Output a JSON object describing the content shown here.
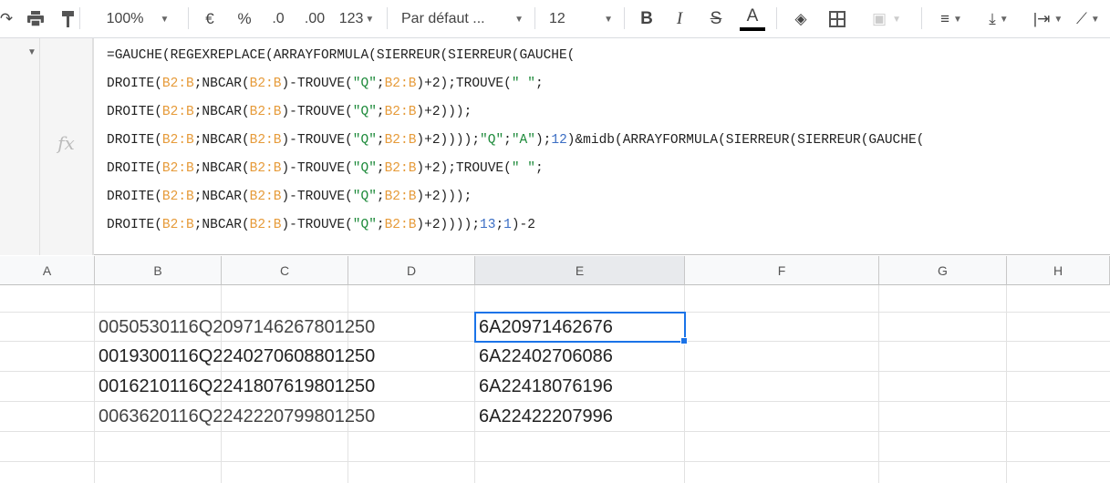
{
  "toolbar": {
    "zoom": "100%",
    "currency": "€",
    "percent": "%",
    "decrease_decimals": ".0",
    "increase_decimals": ".00",
    "more_formats": "123",
    "font": "Par défaut ...",
    "font_size": "12",
    "bold": "B",
    "italic": "I",
    "strikethrough": "S",
    "text_color_label": "A",
    "text_color": "#000000"
  },
  "formula_bar": {
    "fx": "fx",
    "lines": [
      [
        [
          "=GAUCHE(REGEXREPLACE(ARRAYFORMULA(SIERREUR(SIERREUR(GAUCHE(",
          "op"
        ]
      ],
      [
        [
          "DROITE(",
          "op"
        ],
        [
          "B2:B",
          "ref"
        ],
        [
          ";NBCAR(",
          "op"
        ],
        [
          "B2:B",
          "ref"
        ],
        [
          ")-TROUVE(",
          "op"
        ],
        [
          "\"Q\"",
          "str"
        ],
        [
          ";",
          "op"
        ],
        [
          "B2:B",
          "ref"
        ],
        [
          ")+2);TROUVE(",
          "op"
        ],
        [
          "\" \"",
          "str"
        ],
        [
          ";",
          "op"
        ]
      ],
      [
        [
          "DROITE(",
          "op"
        ],
        [
          "B2:B",
          "ref"
        ],
        [
          ";NBCAR(",
          "op"
        ],
        [
          "B2:B",
          "ref"
        ],
        [
          ")-TROUVE(",
          "op"
        ],
        [
          "\"Q\"",
          "str"
        ],
        [
          ";",
          "op"
        ],
        [
          "B2:B",
          "ref"
        ],
        [
          ")+2)));",
          "op"
        ]
      ],
      [
        [
          "DROITE(",
          "op"
        ],
        [
          "B2:B",
          "ref"
        ],
        [
          ";NBCAR(",
          "op"
        ],
        [
          "B2:B",
          "ref"
        ],
        [
          ")-TROUVE(",
          "op"
        ],
        [
          "\"Q\"",
          "str"
        ],
        [
          ";",
          "op"
        ],
        [
          "B2:B",
          "ref"
        ],
        [
          ")+2))));",
          "op"
        ],
        [
          "\"Q\"",
          "str"
        ],
        [
          ";",
          "op"
        ],
        [
          "\"A\"",
          "str"
        ],
        [
          ");",
          "op"
        ],
        [
          "12",
          "num"
        ],
        [
          ")&midb(ARRAYFORMULA(SIERREUR(SIERREUR(GAUCHE(",
          "op"
        ]
      ],
      [
        [
          "DROITE(",
          "op"
        ],
        [
          "B2:B",
          "ref"
        ],
        [
          ";NBCAR(",
          "op"
        ],
        [
          "B2:B",
          "ref"
        ],
        [
          ")-TROUVE(",
          "op"
        ],
        [
          "\"Q\"",
          "str"
        ],
        [
          ";",
          "op"
        ],
        [
          "B2:B",
          "ref"
        ],
        [
          ")+2);TROUVE(",
          "op"
        ],
        [
          "\" \"",
          "str"
        ],
        [
          ";",
          "op"
        ]
      ],
      [
        [
          "DROITE(",
          "op"
        ],
        [
          "B2:B",
          "ref"
        ],
        [
          ";NBCAR(",
          "op"
        ],
        [
          "B2:B",
          "ref"
        ],
        [
          ")-TROUVE(",
          "op"
        ],
        [
          "\"Q\"",
          "str"
        ],
        [
          ";",
          "op"
        ],
        [
          "B2:B",
          "ref"
        ],
        [
          ")+2)));",
          "op"
        ]
      ],
      [
        [
          "DROITE(",
          "op"
        ],
        [
          "B2:B",
          "ref"
        ],
        [
          ";NBCAR(",
          "op"
        ],
        [
          "B2:B",
          "ref"
        ],
        [
          ")-TROUVE(",
          "op"
        ],
        [
          "\"Q\"",
          "str"
        ],
        [
          ";",
          "op"
        ],
        [
          "B2:B",
          "ref"
        ],
        [
          ")+2))));",
          "op"
        ],
        [
          "13",
          "num"
        ],
        [
          ";",
          "op"
        ],
        [
          "1",
          "num"
        ],
        [
          ")-2",
          "op"
        ]
      ]
    ]
  },
  "columns": [
    "A",
    "B",
    "C",
    "D",
    "E",
    "F",
    "G",
    "H"
  ],
  "selected_column": "E",
  "cells": {
    "B": [
      "0050530116Q2097146267801250",
      "0019300116Q2240270608801250",
      "0016210116Q2241807619801250",
      "0063620116Q2242220799801250"
    ],
    "E": [
      "6A20971462676",
      "6A22402706086",
      "6A22418076196",
      "6A22422207996"
    ]
  },
  "colors": {
    "selection": "#1a73e8",
    "reference": "#e69b3a",
    "string": "#1d8a3a",
    "number": "#3b6ec4"
  }
}
